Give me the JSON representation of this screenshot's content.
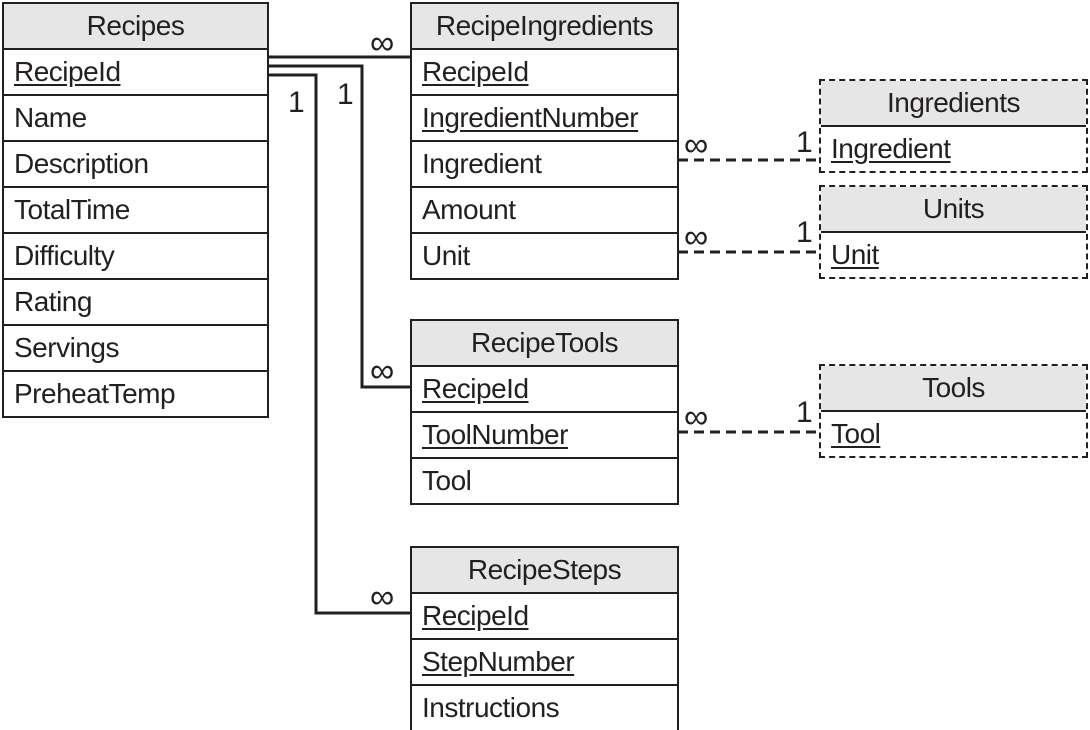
{
  "tables": {
    "recipes": {
      "title": "Recipes",
      "fields": [
        {
          "name": "RecipeId",
          "key": true
        },
        {
          "name": "Name"
        },
        {
          "name": "Description"
        },
        {
          "name": "TotalTime"
        },
        {
          "name": "Difficulty"
        },
        {
          "name": "Rating"
        },
        {
          "name": "Servings"
        },
        {
          "name": "PreheatTemp"
        }
      ]
    },
    "recipe_ingredients": {
      "title": "RecipeIngredients",
      "fields": [
        {
          "name": "RecipeId",
          "key": true
        },
        {
          "name": "IngredientNumber",
          "key": true
        },
        {
          "name": "Ingredient"
        },
        {
          "name": "Amount"
        },
        {
          "name": "Unit"
        }
      ]
    },
    "ingredients": {
      "title": "Ingredients",
      "dashed": true,
      "fields": [
        {
          "name": "Ingredient",
          "key": true
        }
      ]
    },
    "units": {
      "title": "Units",
      "dashed": true,
      "fields": [
        {
          "name": "Unit",
          "key": true
        }
      ]
    },
    "recipe_tools": {
      "title": "RecipeTools",
      "fields": [
        {
          "name": "RecipeId",
          "key": true
        },
        {
          "name": "ToolNumber",
          "key": true
        },
        {
          "name": "Tool"
        }
      ]
    },
    "tools": {
      "title": "Tools",
      "dashed": true,
      "fields": [
        {
          "name": "Tool",
          "key": true
        }
      ]
    },
    "recipe_steps": {
      "title": "RecipeSteps",
      "fields": [
        {
          "name": "RecipeId",
          "key": true
        },
        {
          "name": "StepNumber",
          "key": true
        },
        {
          "name": "Instructions"
        }
      ]
    }
  },
  "relationships": [
    {
      "from": "Recipes.RecipeId",
      "to": "RecipeIngredients.RecipeId",
      "from_card": "1",
      "to_card": "∞",
      "style": "solid"
    },
    {
      "from": "Recipes.RecipeId",
      "to": "RecipeTools.RecipeId",
      "from_card": "1",
      "to_card": "∞",
      "style": "solid"
    },
    {
      "from": "Recipes.RecipeId",
      "to": "RecipeSteps.RecipeId",
      "from_card": "1",
      "to_card": "∞",
      "style": "solid"
    },
    {
      "from": "RecipeIngredients.Ingredient",
      "to": "Ingredients.Ingredient",
      "from_card": "∞",
      "to_card": "1",
      "style": "dashed"
    },
    {
      "from": "RecipeIngredients.Unit",
      "to": "Units.Unit",
      "from_card": "∞",
      "to_card": "1",
      "style": "dashed"
    },
    {
      "from": "RecipeTools.Tool",
      "to": "Tools.Tool",
      "from_card": "∞",
      "to_card": "1",
      "style": "dashed"
    }
  ]
}
